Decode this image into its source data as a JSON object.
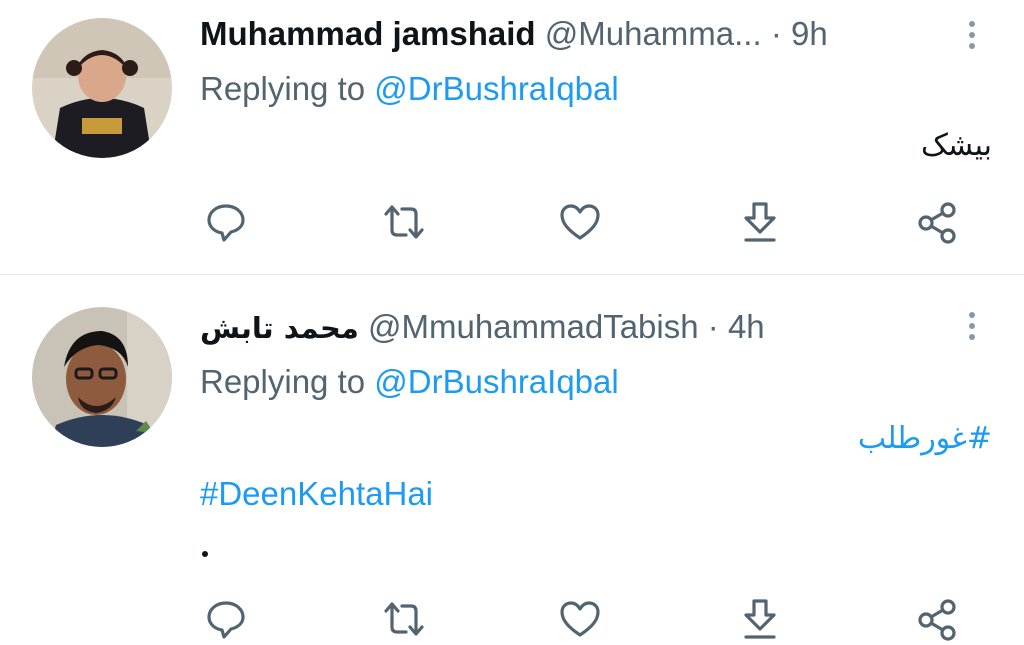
{
  "tweets": [
    {
      "display_name": "Muhammad jamshaid",
      "handle": "@Muhamma...",
      "time": "· 9h",
      "reply_prefix": "Replying to",
      "reply_to": "@DrBushraIqbal",
      "body": "بیشک",
      "avatar": "child-photo"
    },
    {
      "display_name": "محمد تابش",
      "handle": "@MmuhammadTabish",
      "time": "· 4h",
      "reply_prefix": "Replying to",
      "reply_to": "@DrBushraIqbal",
      "hashtag_ur": "#غورطلب",
      "hashtag_en": "#DeenKehtaHai",
      "avatar": "man-photo"
    }
  ],
  "actions": [
    "reply-icon",
    "retweet-icon",
    "like-icon",
    "download-icon",
    "share-icon"
  ],
  "colors": {
    "accent": "#1d9bf0",
    "text": "#0f1419",
    "secondary": "#536471",
    "divider": "#e1e8ed"
  }
}
